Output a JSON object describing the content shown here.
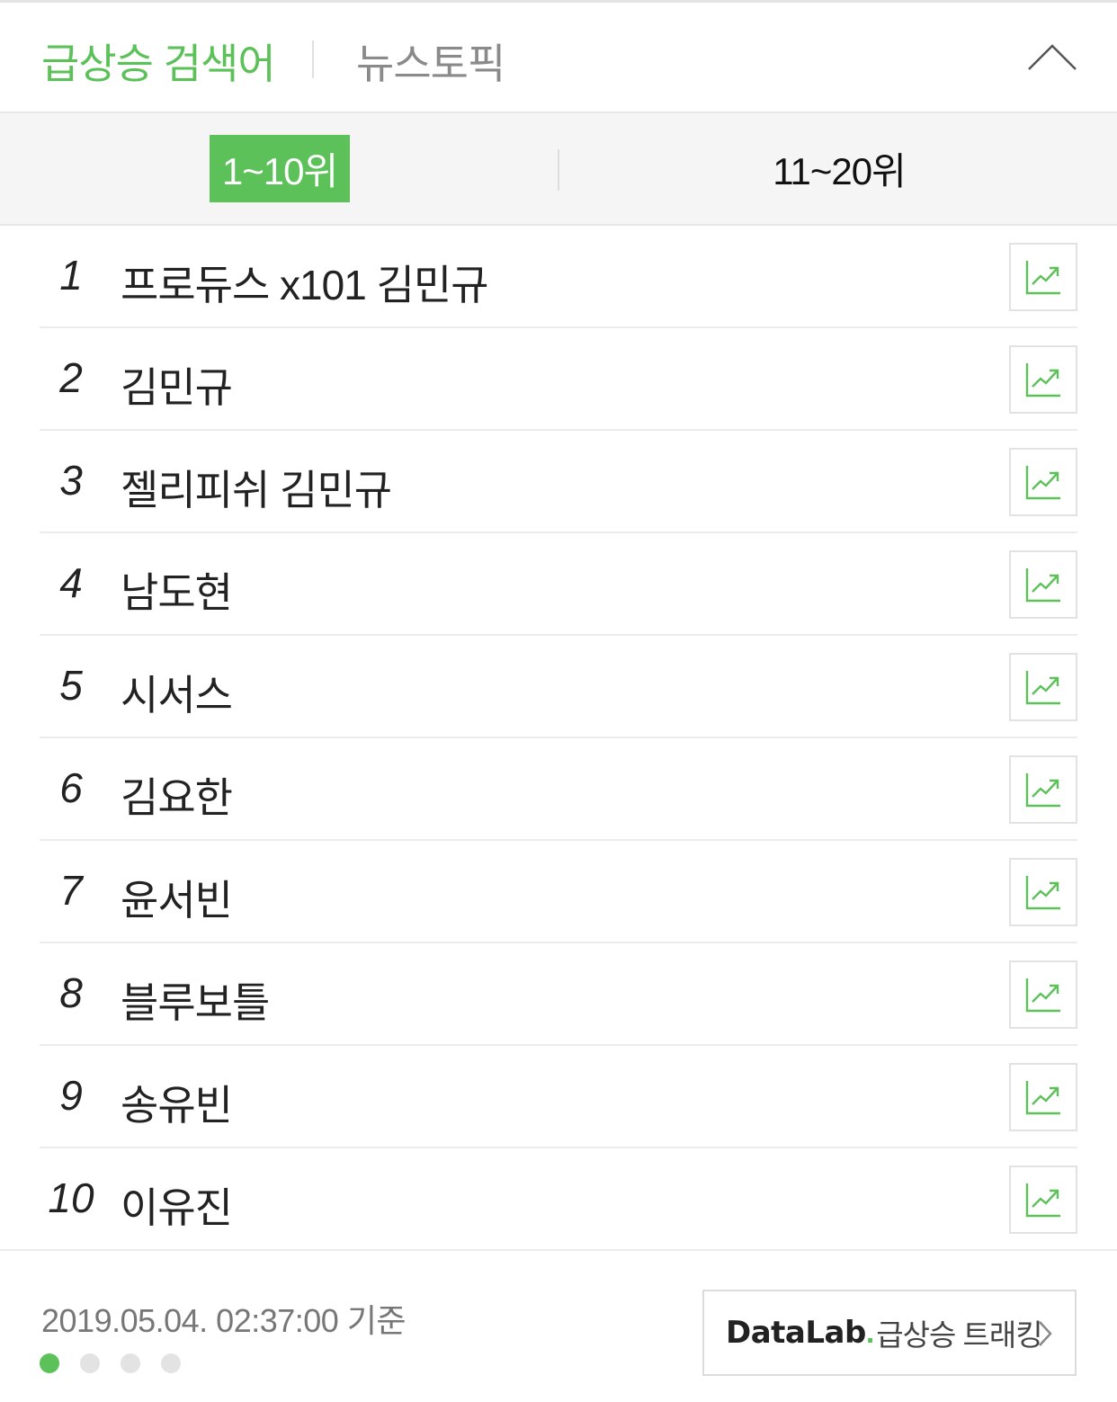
{
  "header": {
    "tab_trending": "급상승 검색어",
    "tab_news": "뉴스토픽",
    "collapse_icon": "chevron-up-icon"
  },
  "range": {
    "active_label": "1~10위",
    "other_label": "11~20위"
  },
  "keywords": [
    {
      "rank": "1",
      "text": "프로듀스 x101 김민규"
    },
    {
      "rank": "2",
      "text": "김민규"
    },
    {
      "rank": "3",
      "text": "젤리피쉬 김민규"
    },
    {
      "rank": "4",
      "text": "남도현"
    },
    {
      "rank": "5",
      "text": "시서스"
    },
    {
      "rank": "6",
      "text": "김요한"
    },
    {
      "rank": "7",
      "text": "윤서빈"
    },
    {
      "rank": "8",
      "text": "블루보틀"
    },
    {
      "rank": "9",
      "text": "송유빈"
    },
    {
      "rank": "10",
      "text": "이유진"
    }
  ],
  "trend_icon": "trend-chart-icon",
  "footer": {
    "timestamp": "2019.05.04. 02:37:00 기준",
    "page_count": 4,
    "active_page": 1,
    "datalab_brand": "DataLab",
    "datalab_dot": ".",
    "datalab_label": "급상승 트래킹"
  },
  "colors": {
    "accent": "#5cc159",
    "text": "#222222",
    "muted": "#8a8a8a"
  }
}
